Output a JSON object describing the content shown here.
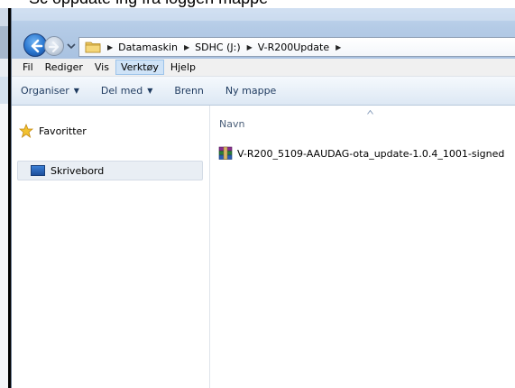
{
  "caption": {
    "text": "Sc oppdate ing fra loggen mappe"
  },
  "address": {
    "crumbs": [
      "Datamaskin",
      "SDHC (J:)",
      "V-R200Update"
    ]
  },
  "menubar": {
    "items": [
      "Fil",
      "Rediger",
      "Vis",
      "Verktøy",
      "Hjelp"
    ],
    "active": "Verktøy"
  },
  "toolbar": {
    "organize": "Organiser",
    "share": "Del med",
    "burn": "Brenn",
    "new_folder": "Ny mappe"
  },
  "navpane": {
    "favorites": "Favoritter",
    "desktop": "Skrivebord"
  },
  "content": {
    "column_header": "Navn",
    "files": [
      {
        "name": "V-R200_5109-AAUDAG-ota_update-1.0.4_1001-signed",
        "icon": "winrar-archive-icon"
      }
    ]
  },
  "colors": {
    "accent": "#2a76cf",
    "command_text": "#1e3a5f",
    "menu_active": "#cfe3f7"
  }
}
